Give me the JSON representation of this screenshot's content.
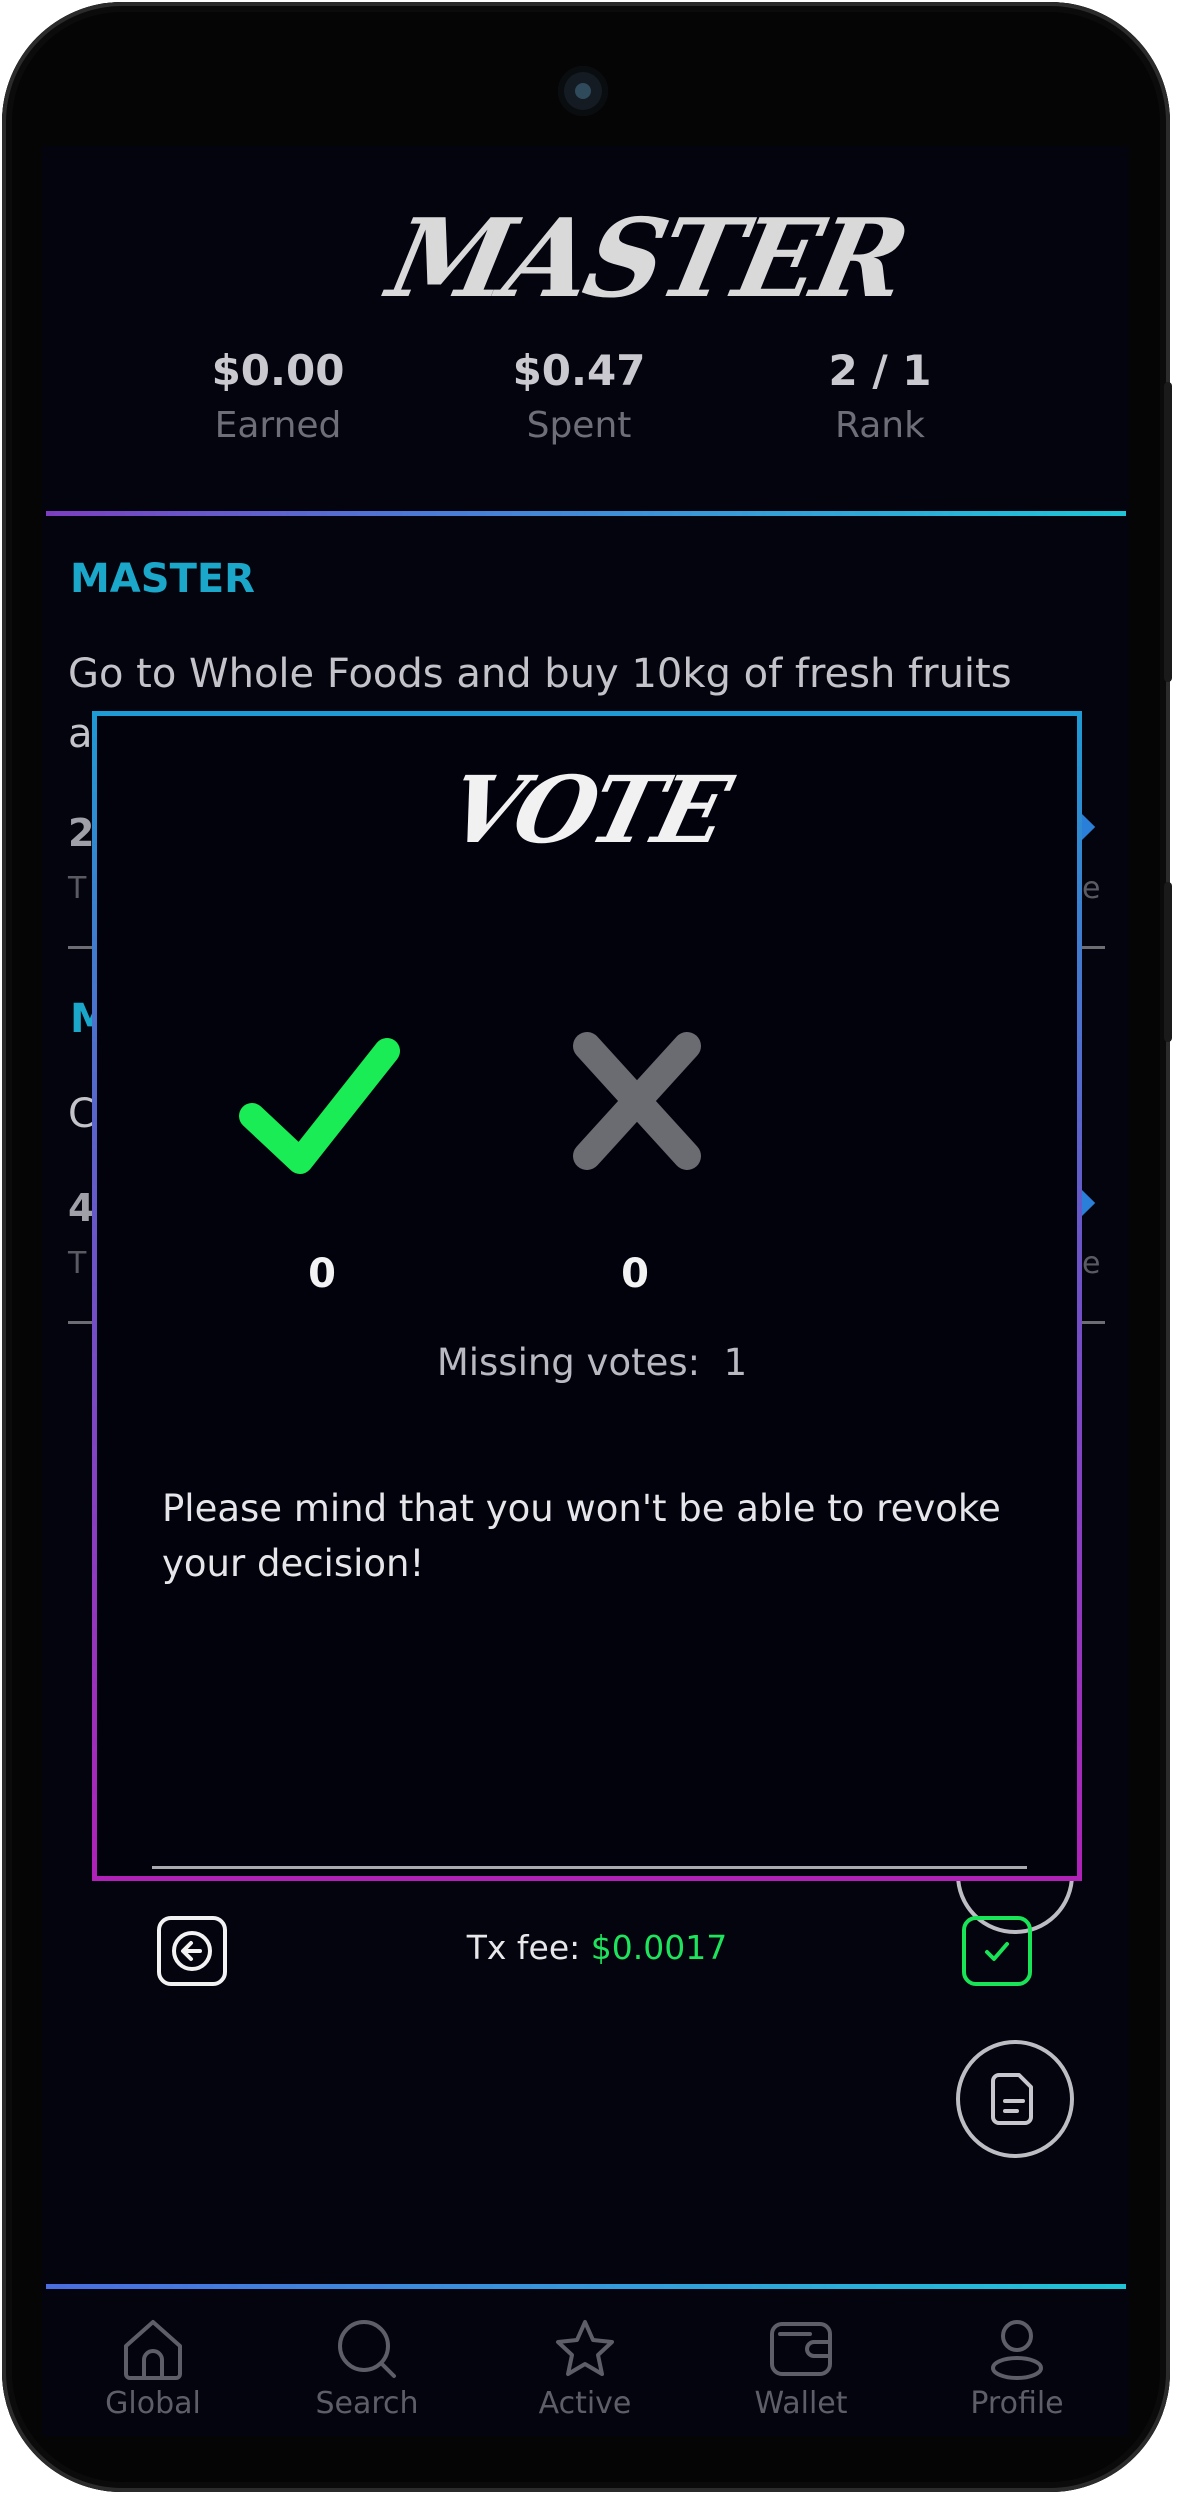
{
  "app": {
    "logo_text": "MASTER"
  },
  "stats": [
    {
      "value": "$0.00",
      "label": "Earned"
    },
    {
      "value": "$0.47",
      "label": "Spent"
    },
    {
      "value": "2 / 1",
      "label": "Rank"
    }
  ],
  "tasks": [
    {
      "title": "MASTER",
      "description": "Go to Whole Foods and buy 10kg of fresh fruits",
      "desc_peek": "a",
      "value_peek": "2",
      "sub_peek": "T",
      "right_peek": "e"
    },
    {
      "title_peek": "M",
      "desc_peek": "C",
      "value_peek": "4",
      "sub_peek": "T",
      "right_peek": "e"
    }
  ],
  "modal": {
    "title": "VOTE",
    "yes_icon": "check-icon",
    "no_icon": "x-icon",
    "yes_count": "0",
    "no_count": "0",
    "missing_label": "Missing votes:",
    "missing_count": "1",
    "warning": "Please mind that you won't be able to revoke your decision!",
    "fee_label": "Tx fee:",
    "fee_amount": "$0.0017"
  },
  "nav": [
    {
      "label": "Global",
      "icon": "home-icon"
    },
    {
      "label": "Search",
      "icon": "search-icon"
    },
    {
      "label": "Active",
      "icon": "star-icon"
    },
    {
      "label": "Wallet",
      "icon": "wallet-icon"
    },
    {
      "label": "Profile",
      "icon": "profile-icon"
    }
  ],
  "colors": {
    "accent_cyan": "#1aa7c9",
    "accent_green": "#1ee35c",
    "accent_magenta": "#b021b8",
    "background": "#04040f"
  }
}
